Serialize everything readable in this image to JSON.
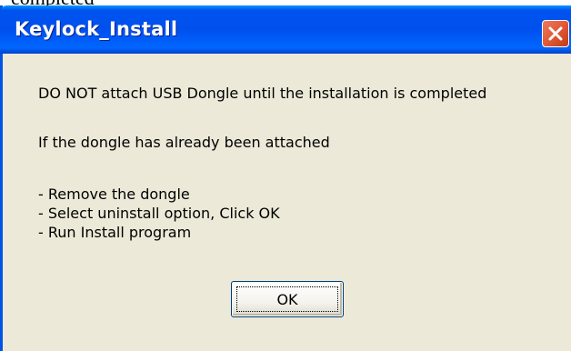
{
  "background_text": "completed",
  "dialog": {
    "title": "Keylock_Install",
    "message_line1": "DO NOT attach USB Dongle until the installation is completed",
    "message_line2": "If the dongle has already been attached",
    "steps": [
      "- Remove the dongle",
      "- Select uninstall option, Click OK",
      "- Run Install program"
    ],
    "ok_label": "OK",
    "close_icon": "close-icon"
  },
  "colors": {
    "titlebar": "#0054e3",
    "dialog_bg": "#ece9d8",
    "close_button": "#e45c3a"
  }
}
